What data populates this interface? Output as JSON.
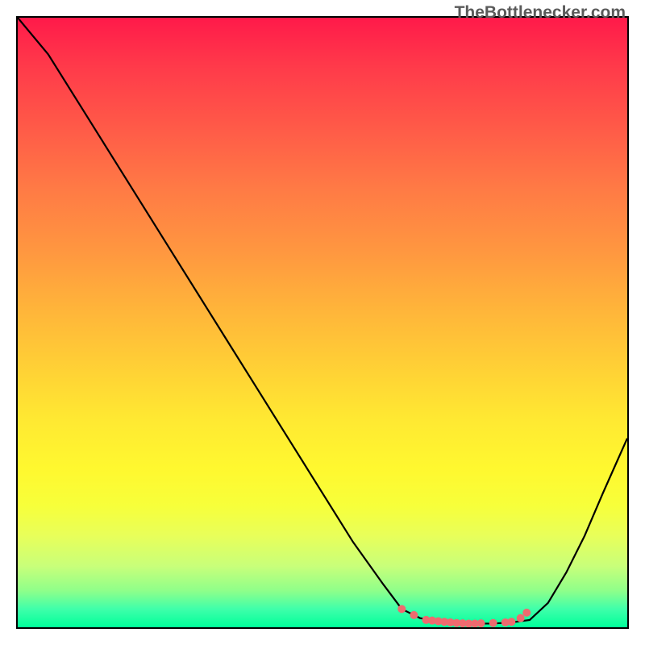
{
  "attribution": "TheBottlenecker.com",
  "chart_data": {
    "type": "line",
    "title": "",
    "xlabel": "",
    "ylabel": "",
    "xlim": [
      0,
      100
    ],
    "ylim": [
      0,
      100
    ],
    "series": [
      {
        "name": "curve",
        "x": [
          0,
          5,
          10,
          15,
          20,
          25,
          30,
          35,
          40,
          45,
          50,
          55,
          60,
          63,
          66,
          69,
          72,
          75,
          78,
          81,
          84,
          87,
          90,
          93,
          96,
          100
        ],
        "y": [
          100,
          94,
          86,
          78,
          70,
          62,
          54,
          46,
          38,
          30,
          22,
          14,
          7,
          3,
          1.5,
          1,
          0.8,
          0.6,
          0.6,
          0.8,
          1.2,
          4,
          9,
          15,
          22,
          31
        ]
      },
      {
        "name": "highlight-dots",
        "x": [
          63,
          65,
          67,
          68,
          69,
          70,
          71,
          72,
          73,
          74,
          75,
          76,
          78,
          80,
          81,
          82.5,
          83.5
        ],
        "y": [
          3.0,
          2.0,
          1.2,
          1.1,
          1.0,
          0.9,
          0.8,
          0.7,
          0.65,
          0.6,
          0.6,
          0.65,
          0.7,
          0.8,
          0.9,
          1.5,
          2.4
        ]
      }
    ],
    "background_gradient": {
      "top": "#ff1a4a",
      "bottom": "#00ff9a"
    },
    "highlight_color": "#ef6a6f"
  }
}
